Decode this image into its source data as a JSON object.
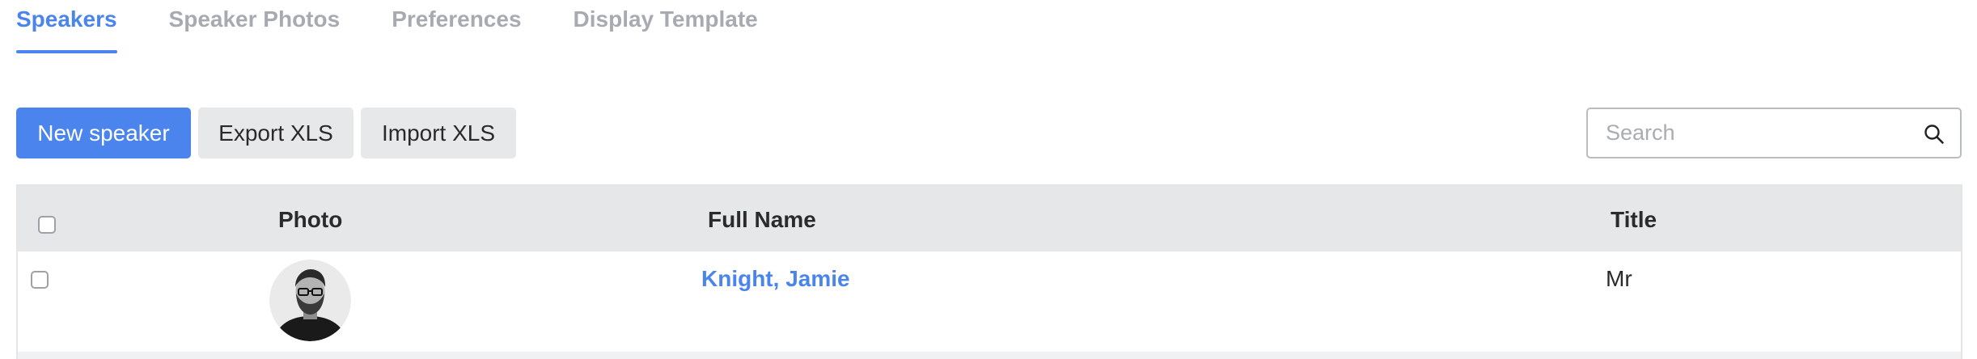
{
  "tabs": [
    {
      "label": "Speakers",
      "active": true
    },
    {
      "label": "Speaker Photos",
      "active": false
    },
    {
      "label": "Preferences",
      "active": false
    },
    {
      "label": "Display Template",
      "active": false
    }
  ],
  "toolbar": {
    "new_label": "New speaker",
    "export_label": "Export XLS",
    "import_label": "Import XLS"
  },
  "search": {
    "placeholder": "Search",
    "icon": "search-icon"
  },
  "table": {
    "columns": [
      "Photo",
      "Full Name",
      "Title"
    ],
    "rows": [
      {
        "checked": false,
        "photo": "speaker-photo",
        "full_name": "Knight, Jamie",
        "title": "Mr"
      }
    ]
  },
  "colors": {
    "accent": "#4a84ec",
    "tab_inactive": "#a7abb1",
    "header_bg": "#e6e7e9",
    "secondary_btn_bg": "#e7e8ea"
  }
}
